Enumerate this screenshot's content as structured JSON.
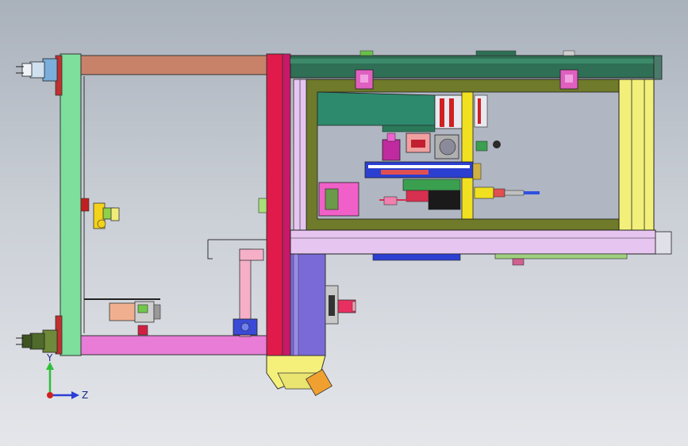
{
  "view": {
    "background_top": "#a9b1bb",
    "background_bottom": "#e4e6ea"
  },
  "triad": {
    "y_label": "Y",
    "z_label": "Z",
    "y_color": "#2fbf3a",
    "z_color": "#2a3fd6",
    "x_color": "#d02020"
  },
  "model_colors": {
    "left_frame": "#7ede9c",
    "top_bar_left": "#c8826a",
    "bottom_bar_left": "#e87cd6",
    "red_column": "#e01a4a",
    "top_rail": "#2f6f55",
    "olive_frame": "#6f7a2a",
    "yellow_panel": "#f2f07a",
    "lavender_bar": "#e6c6f0",
    "purple_block": "#7a6ad8",
    "hopper": "#f4f07a",
    "teal_plate": "#2e8a6c",
    "inner_bg": "#b0b6c2",
    "blue_bar": "#2b3fd1",
    "magenta": "#d64fc0",
    "pink_bracket": "#f5b0c8"
  }
}
